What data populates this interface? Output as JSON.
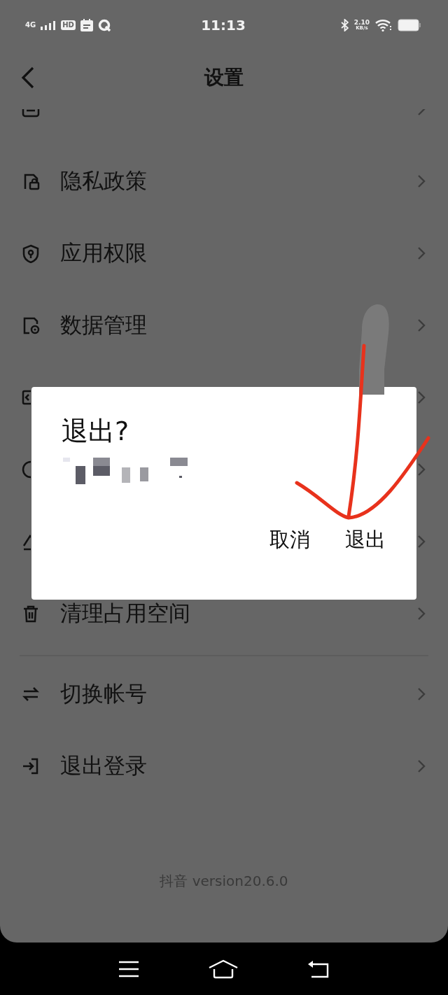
{
  "status_bar": {
    "network": "4G",
    "hd": "HD",
    "time": "11:13",
    "speed": "2.10",
    "speed_unit": "KB/s"
  },
  "header": {
    "title": "设置"
  },
  "settings": [
    {
      "kind": "cut"
    },
    {
      "kind": "row",
      "label": "隐私政策"
    },
    {
      "kind": "row",
      "label": "应用权限"
    },
    {
      "kind": "row",
      "label": "数据管理"
    },
    {
      "kind": "covered"
    },
    {
      "kind": "covered"
    },
    {
      "kind": "covered"
    },
    {
      "kind": "row",
      "label": "清理占用空间"
    }
  ],
  "accounts": [
    {
      "kind": "row",
      "label": "切换帐号"
    },
    {
      "kind": "row",
      "label": "退出登录"
    }
  ],
  "dialog": {
    "title": "退出?",
    "buttons": [
      "取消",
      "退出"
    ]
  },
  "footer": "抖音 version20.6.0"
}
